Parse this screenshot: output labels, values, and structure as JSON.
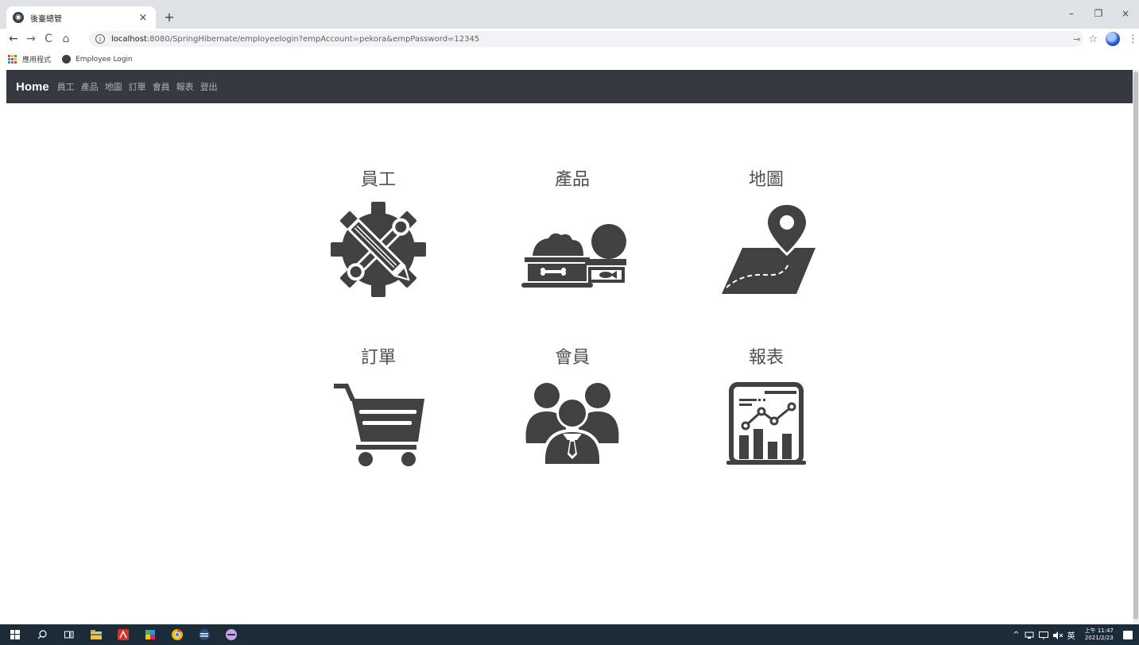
{
  "browser": {
    "tab_title": "後臺總管",
    "tab_close": "×",
    "new_tab": "+",
    "window_minimize": "–",
    "window_restore": "❐",
    "window_close": "×",
    "nav_back": "←",
    "nav_forward": "→",
    "nav_reload": "C",
    "nav_home": "⌂",
    "url_info": "i",
    "url_host": "localhost",
    "url_rest": ":8080/SpringHibernate/employeelogin?empAccount=pekora&empPassword=12345",
    "key_glyph": "⊸",
    "star_glyph": "☆",
    "menu_glyph": "⋮",
    "bookmarks": {
      "apps_label": "應用程式",
      "item_label": "Employee Login"
    }
  },
  "navbar": {
    "brand": "Home",
    "links": [
      "員工",
      "產品",
      "地圖",
      "訂單",
      "會員",
      "報表",
      "登出"
    ]
  },
  "tiles": [
    {
      "label": "員工",
      "icon": "gear-tools-icon"
    },
    {
      "label": "產品",
      "icon": "pet-bowls-icon"
    },
    {
      "label": "地圖",
      "icon": "map-pin-icon"
    },
    {
      "label": "訂單",
      "icon": "shopping-cart-icon"
    },
    {
      "label": "會員",
      "icon": "people-group-icon"
    },
    {
      "label": "報表",
      "icon": "chart-report-icon"
    }
  ],
  "taskbar": {
    "tray_lang": "英",
    "tray_time": "上午 11:47",
    "tray_date": "2021/2/23",
    "tray_caret": "^"
  },
  "colors": {
    "navbar_bg": "#343a40",
    "icon_fill": "#414141",
    "tile_label": "#505050",
    "taskbar_bg": "#1b2b38"
  }
}
